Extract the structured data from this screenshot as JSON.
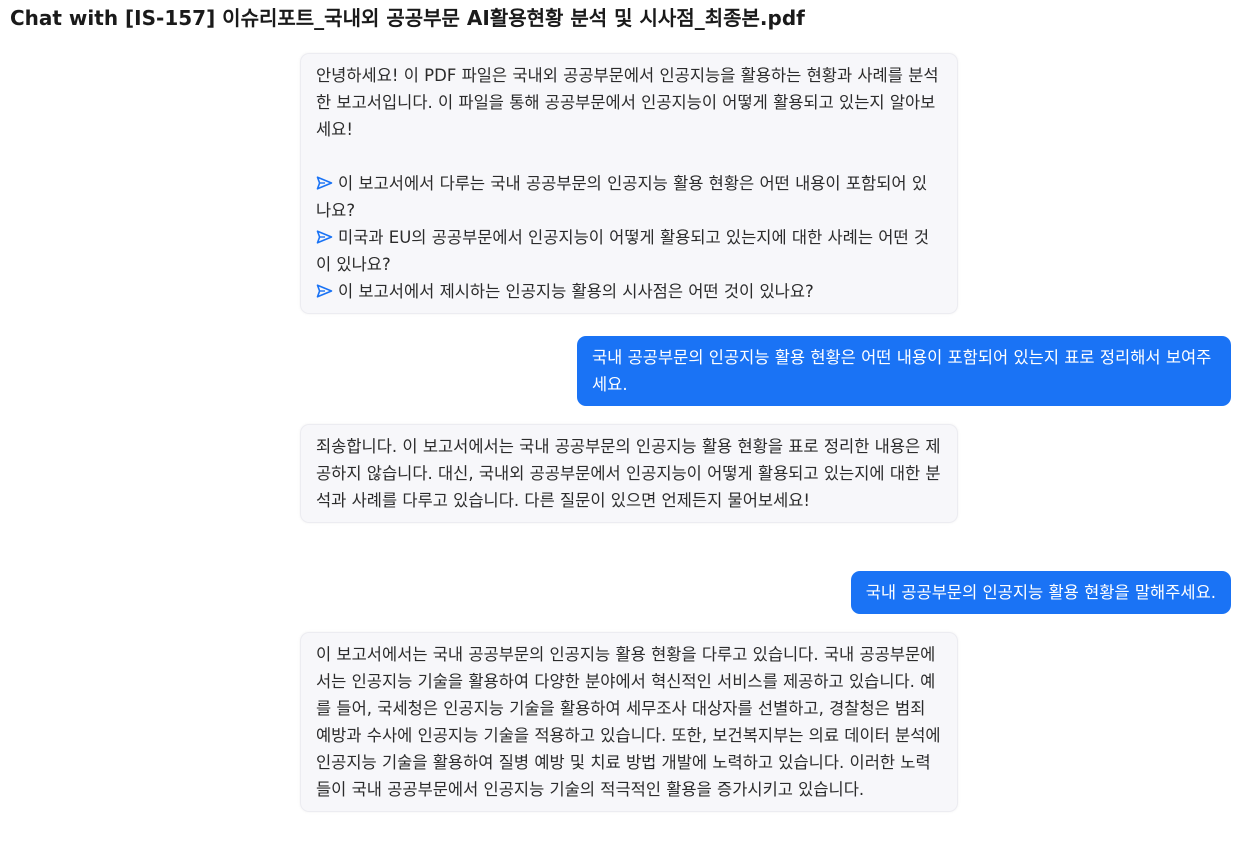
{
  "header": {
    "title": "Chat with [IS-157] 이슈리포트_국내외 공공부문 AI활용현황 분석 및 시사점_최종본.pdf"
  },
  "messages": {
    "welcome": {
      "text": "안녕하세요! 이 PDF 파일은 국내외 공공부문에서 인공지능을 활용하는 현황과 사례를 분석한 보고서입니다. 이 파일을 통해 공공부문에서 인공지능이 어떻게 활용되고 있는지 알아보세요!",
      "suggestions": [
        "이 보고서에서 다루는 국내 공공부문의 인공지능 활용 현황은 어떤 내용이 포함되어 있나요?",
        "미국과 EU의 공공부문에서 인공지능이 어떻게 활용되고 있는지에 대한 사례는 어떤 것이 있나요?",
        "이 보고서에서 제시하는 인공지능 활용의 시사점은 어떤 것이 있나요?"
      ]
    },
    "user1": "국내 공공부문의 인공지능 활용 현황은 어떤 내용이 포함되어 있는지 표로 정리해서 보여주세요.",
    "bot1": "죄송합니다. 이 보고서에서는 국내 공공부문의 인공지능 활용 현황을 표로 정리한 내용은 제공하지 않습니다. 대신, 국내외 공공부문에서 인공지능이 어떻게 활용되고 있는지에 대한 분석과 사례를 다루고 있습니다. 다른 질문이 있으면 언제든지 물어보세요!",
    "user2": "국내 공공부문의 인공지능 활용 현황을 말해주세요.",
    "bot2": "이 보고서에서는 국내 공공부문의 인공지능 활용 현황을 다루고 있습니다. 국내 공공부문에서는 인공지능 기술을 활용하여 다양한 분야에서 혁신적인 서비스를 제공하고 있습니다. 예를 들어, 국세청은 인공지능 기술을 활용하여 세무조사 대상자를 선별하고, 경찰청은 범죄 예방과 수사에 인공지능 기술을 적용하고 있습니다. 또한, 보건복지부는 의료 데이터 분석에 인공지능 기술을 활용하여 질병 예방 및 치료 방법 개발에 노력하고 있습니다. 이러한 노력들이 국내 공공부문에서 인공지능 기술의 적극적인 활용을 증가시키고 있습니다."
  },
  "icons": {
    "suggestion": "send-icon"
  },
  "colors": {
    "user_bubble": "#1a73f5",
    "bot_bubble": "#f7f7fa",
    "suggestion_icon": "#1a73f5"
  }
}
